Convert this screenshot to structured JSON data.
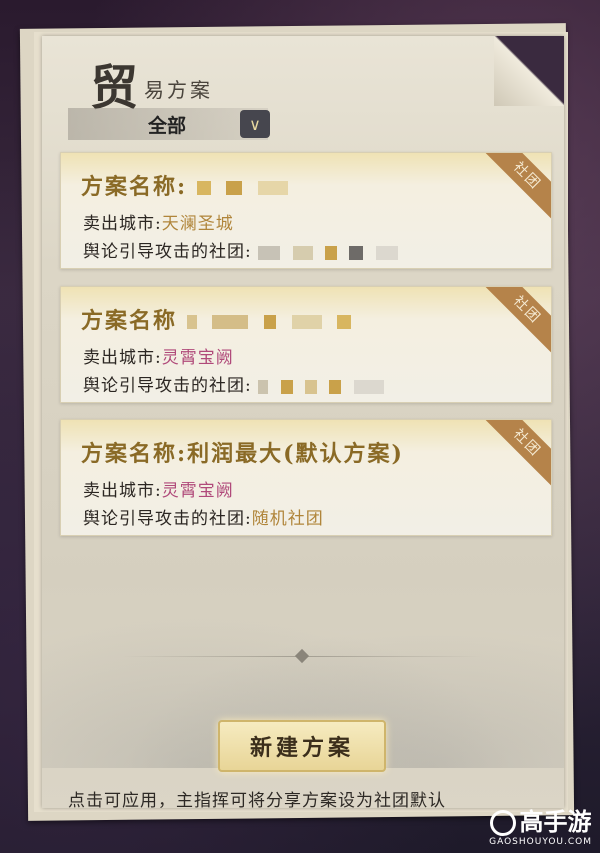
{
  "header": {
    "title_big": "贸",
    "title_small": "易方案"
  },
  "filter": {
    "selected": "全部"
  },
  "cards": [
    {
      "name": "方案名称:",
      "city_label": "卖出城市:",
      "city": "天澜圣城",
      "attack_label": "舆论引导攻击的社团:",
      "attack": "",
      "ribbon": "社团",
      "city_color": "#b0853a"
    },
    {
      "name": "方案名称",
      "city_label": "卖出城市:",
      "city": "灵霄宝阙",
      "attack_label": "舆论引导攻击的社团:",
      "attack": "",
      "ribbon": "社团",
      "city_color": "#b04a7a"
    },
    {
      "name": "方案名称:利润最大(默认方案)",
      "city_label": "卖出城市:",
      "city": "灵霄宝阙",
      "attack_label": "舆论引导攻击的社团:",
      "attack": "随机社团",
      "ribbon": "社团",
      "city_color": "#b04a7a"
    }
  ],
  "new_button": "新建方案",
  "hint": "点击可应用，主指挥可将分享方案设为社团默认",
  "watermark": {
    "main": "高手游",
    "sub": "GAOSHOUYOU.COM"
  }
}
